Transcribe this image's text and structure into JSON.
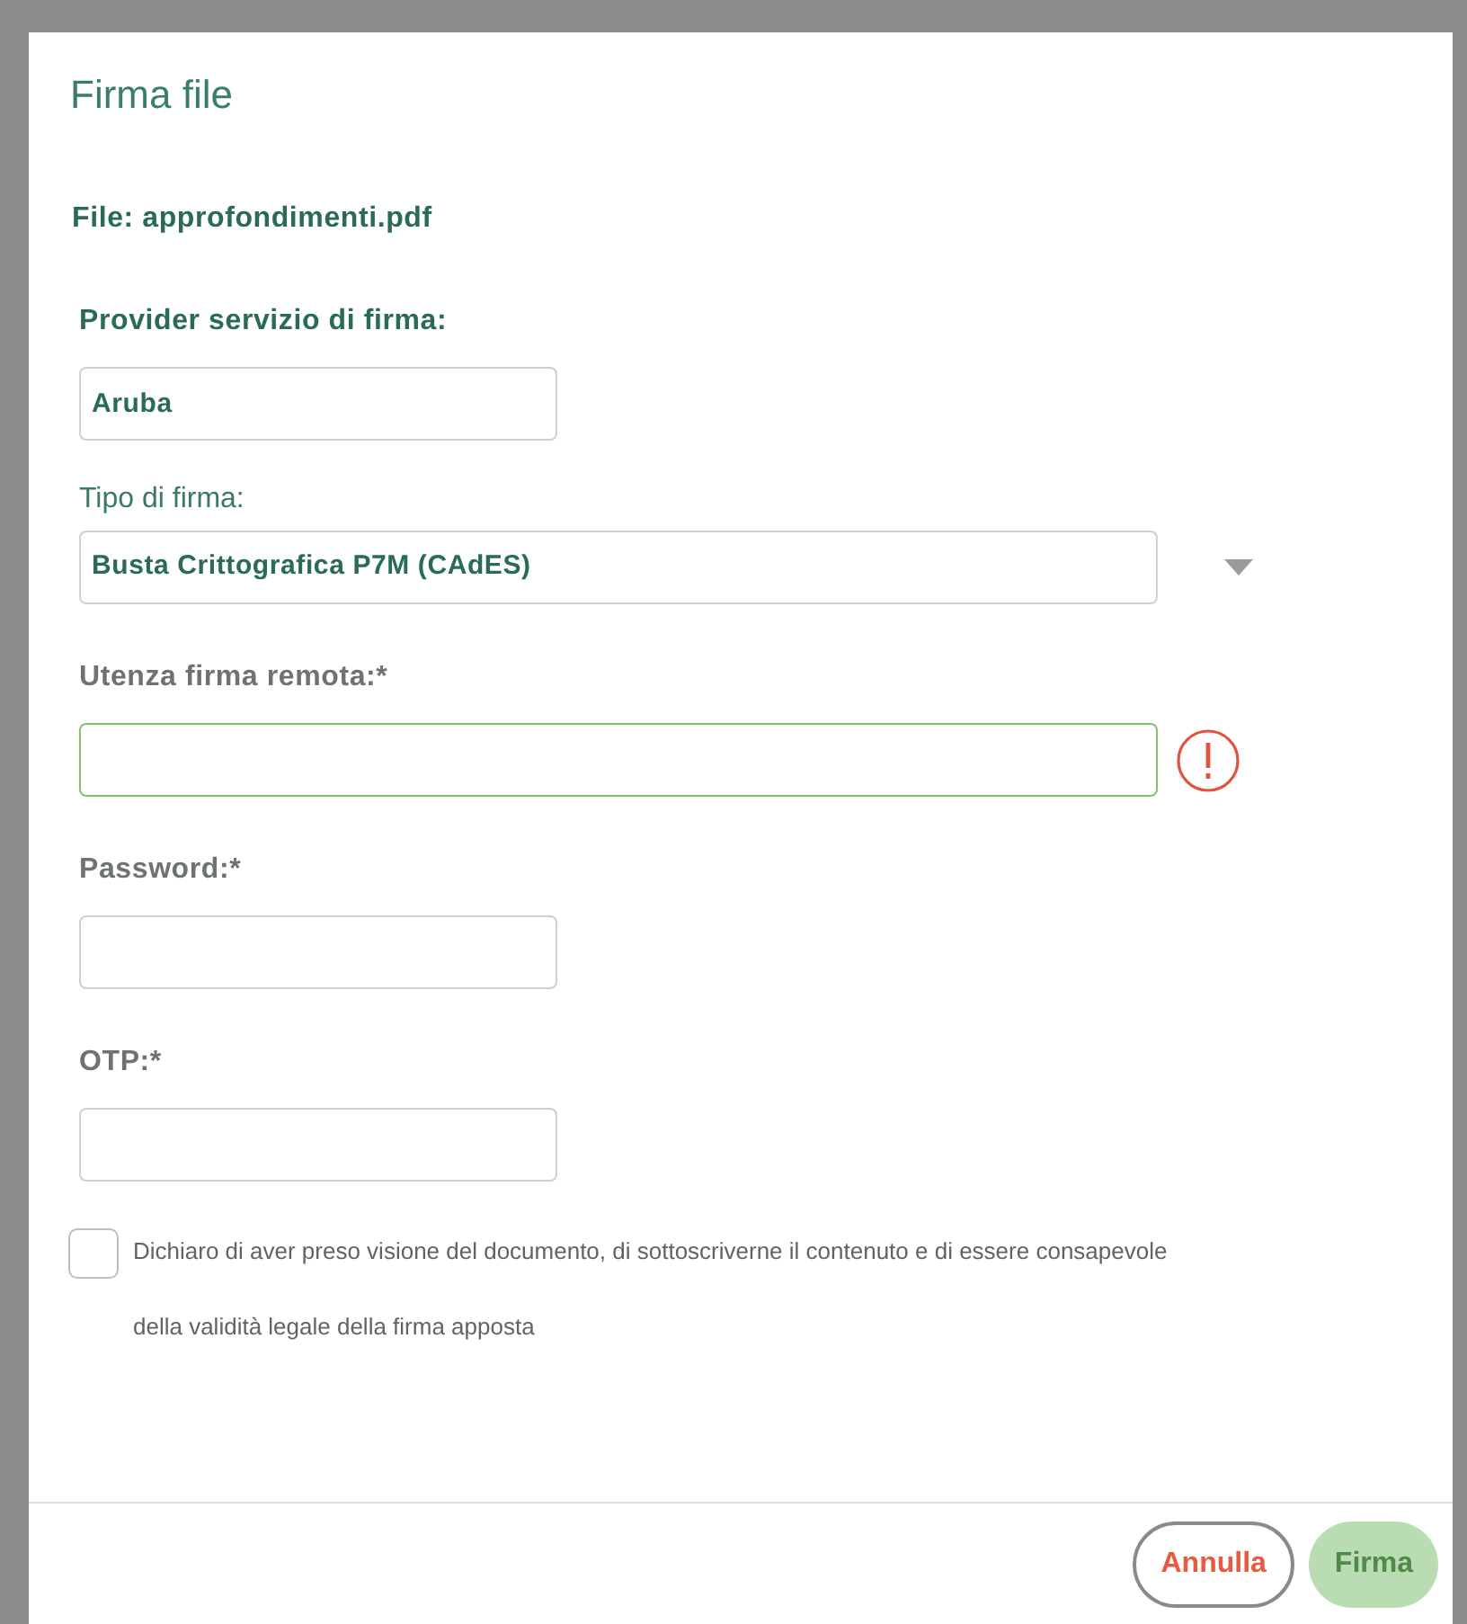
{
  "dialog": {
    "title": "Firma file",
    "file_label": "File: approfondimenti.pdf",
    "fields": [
      {
        "kind": "heading",
        "label": "Provider servizio di firma:",
        "value": "Aruba",
        "focused": false,
        "error": false
      },
      {
        "kind": "select",
        "label": "Tipo di firma:",
        "value": "Busta Crittografica P7M (CAdES)",
        "focused": false,
        "error": false
      },
      {
        "kind": "wide",
        "label": "Utenza firma remota:*",
        "focused": true,
        "error": true
      },
      {
        "kind": "short",
        "label": "Password:*",
        "focused": false,
        "error": false
      },
      {
        "kind": "short",
        "label": "OTP:*",
        "focused": false,
        "error": false
      }
    ],
    "declaration": {
      "checked": false,
      "text": "Dichiaro di aver preso visione del documento, di sottoscriverne il contenuto e di essere consapevole della validità legale della firma apposta"
    },
    "buttons": [
      {
        "kind": "cancel",
        "label": "Annulla",
        "disabled": false
      },
      {
        "kind": "primary",
        "label": "Firma",
        "disabled": true
      }
    ]
  }
}
